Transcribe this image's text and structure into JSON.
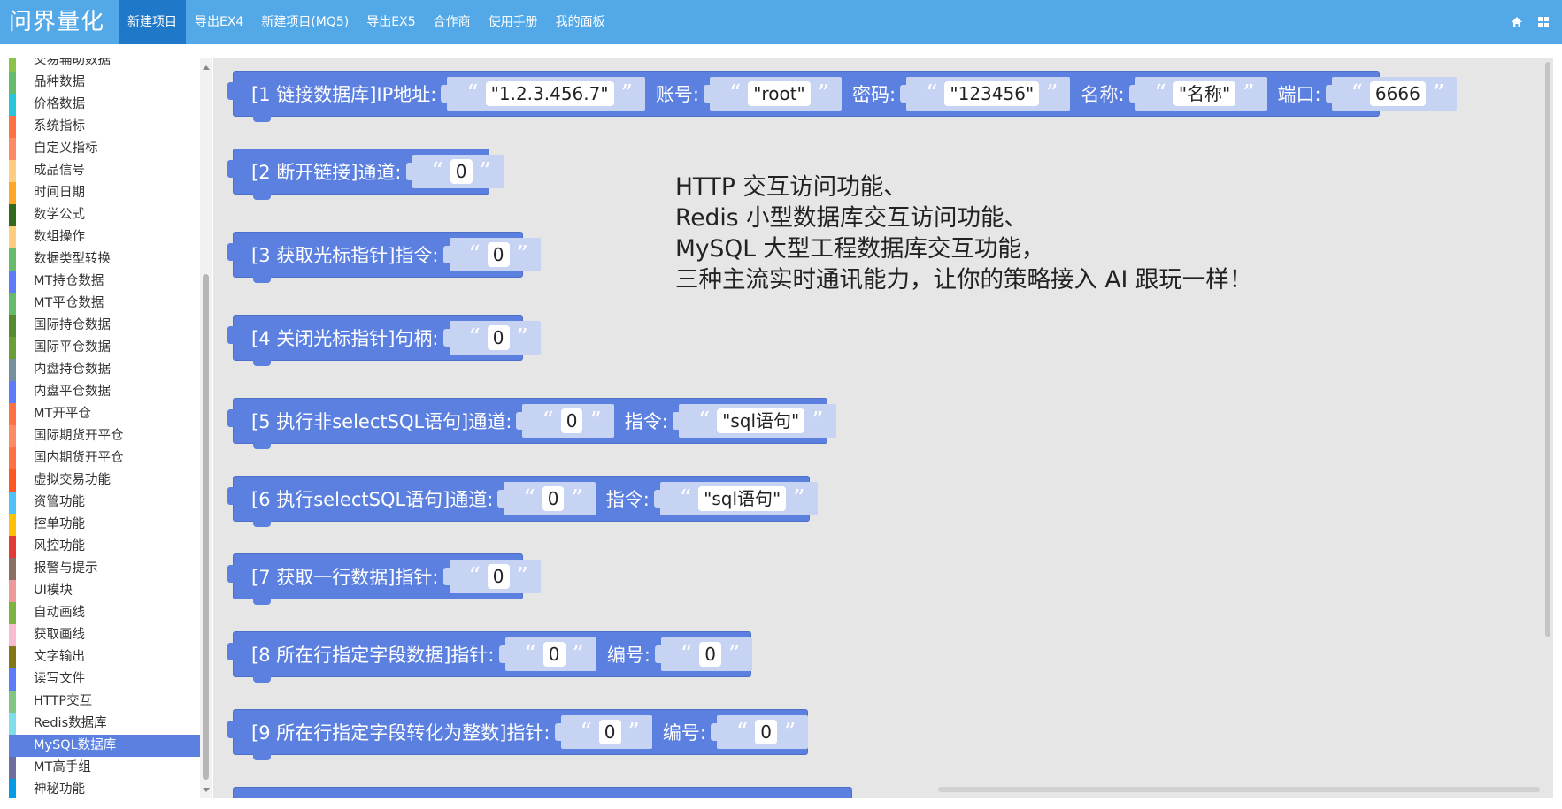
{
  "app": {
    "brand": "问界量化"
  },
  "nav": {
    "items": [
      {
        "label": "新建项目",
        "active": true
      },
      {
        "label": "导出EX4",
        "active": false
      },
      {
        "label": "新建项目(MQ5)",
        "active": false
      },
      {
        "label": "导出EX5",
        "active": false
      },
      {
        "label": "合作商",
        "active": false
      },
      {
        "label": "使用手册",
        "active": false
      },
      {
        "label": "我的面板",
        "active": false
      }
    ],
    "right_icons": [
      "home-icon",
      "grid-icon"
    ]
  },
  "sidebar": {
    "items": [
      {
        "label": "交易辅助数据",
        "color": "#8bc34a"
      },
      {
        "label": "品种数据",
        "color": "#66bb6a"
      },
      {
        "label": "价格数据",
        "color": "#26c6da"
      },
      {
        "label": "系统指标",
        "color": "#ff7043"
      },
      {
        "label": "自定义指标",
        "color": "#ff8a65"
      },
      {
        "label": "成品信号",
        "color": "#ffcc80"
      },
      {
        "label": "时间日期",
        "color": "#ffa726"
      },
      {
        "label": "数学公式",
        "color": "#33691e"
      },
      {
        "label": "数组操作",
        "color": "#ffcc80"
      },
      {
        "label": "数据类型转换",
        "color": "#66bb6a"
      },
      {
        "label": "MT持仓数据",
        "color": "#5c7cfa"
      },
      {
        "label": "MT平仓数据",
        "color": "#66bb6a"
      },
      {
        "label": "国际持仓数据",
        "color": "#558b2f"
      },
      {
        "label": "国际平仓数据",
        "color": "#689f38"
      },
      {
        "label": "内盘持仓数据",
        "color": "#78909c"
      },
      {
        "label": "内盘平仓数据",
        "color": "#5c7cfa"
      },
      {
        "label": "MT开平仓",
        "color": "#ff7043"
      },
      {
        "label": "国际期货开平仓",
        "color": "#ff8a65"
      },
      {
        "label": "国内期货开平仓",
        "color": "#ff7043"
      },
      {
        "label": "虚拟交易功能",
        "color": "#ff5722"
      },
      {
        "label": "资管功能",
        "color": "#4fc3f7"
      },
      {
        "label": "控单功能",
        "color": "#ffc107"
      },
      {
        "label": "风控功能",
        "color": "#e53935"
      },
      {
        "label": "报警与提示",
        "color": "#8d6e63"
      },
      {
        "label": "UI模块",
        "color": "#ef9a9a"
      },
      {
        "label": "自动画线",
        "color": "#7cb342"
      },
      {
        "label": "获取画线",
        "color": "#f8bbd0"
      },
      {
        "label": "文字输出",
        "color": "#827717"
      },
      {
        "label": "读写文件",
        "color": "#5c7cfa"
      },
      {
        "label": "HTTP交互",
        "color": "#81c784"
      },
      {
        "label": "Redis数据库",
        "color": "#80deea"
      },
      {
        "label": "MySQL数据库",
        "color": "#5b80e0",
        "selected": true
      },
      {
        "label": "MT高手组",
        "color": "#6d6d9e"
      },
      {
        "label": "神秘功能",
        "color": "#039be5"
      }
    ]
  },
  "blocks": {
    "b1": {
      "label": "[1 链接数据库]IP地址:",
      "ip": "\"1.2.3.456.7\"",
      "account_label": "账号:",
      "account": "\"root\"",
      "password_label": "密码:",
      "password": "\"123456\"",
      "name_label": "名称:",
      "name": "\"名称\"",
      "port_label": "端口:",
      "port": "6666"
    },
    "b2": {
      "label": "[2 断开链接]通道:",
      "channel": "0"
    },
    "b3": {
      "label": "[3 获取光标指针]指令:",
      "command": "0"
    },
    "b4": {
      "label": "[4 关闭光标指针]句柄:",
      "handle": "0"
    },
    "b5": {
      "label": "[5 执行非selectSQL语句]通道:",
      "channel": "0",
      "cmd_label": "指令:",
      "command": "\"sql语句\""
    },
    "b6": {
      "label": "[6 执行selectSQL语句]通道:",
      "channel": "0",
      "cmd_label": "指令:",
      "command": "\"sql语句\""
    },
    "b7": {
      "label": "[7 获取一行数据]指针:",
      "pointer": "0"
    },
    "b8": {
      "label": "[8 所在行指定字段数据]指针:",
      "pointer": "0",
      "index_label": "编号:",
      "index": "0"
    },
    "b9": {
      "label": "[9 所在行指定字段转化为整数]指针:",
      "pointer": "0",
      "index_label": "编号:",
      "index": "0"
    }
  },
  "promo": {
    "lines": [
      "HTTP 交互访问功能、",
      "Redis 小型数据库交互访问功能、",
      "MySQL 大型工程数据库交互功能，",
      "三种主流实时通讯能力，让你的策略接入 AI 跟玩一样！"
    ]
  },
  "quotes": {
    "open": "“",
    "close": "”"
  }
}
